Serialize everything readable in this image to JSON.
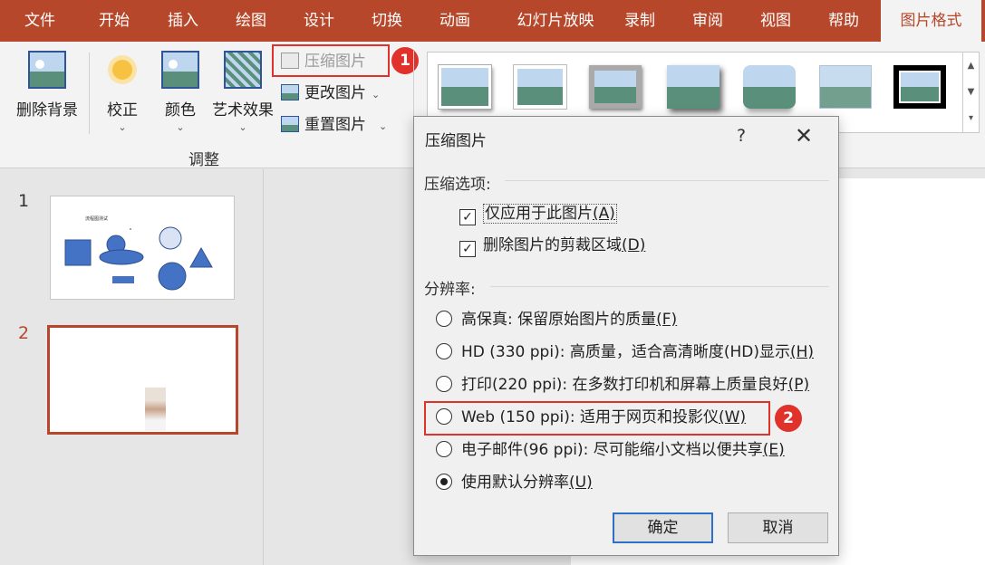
{
  "tabs": [
    {
      "label": "文件",
      "active": false
    },
    {
      "label": "开始",
      "active": false
    },
    {
      "label": "插入",
      "active": false
    },
    {
      "label": "绘图",
      "active": false
    },
    {
      "label": "设计",
      "active": false
    },
    {
      "label": "切换",
      "active": false
    },
    {
      "label": "动画",
      "active": false
    },
    {
      "label": "幻灯片放映",
      "active": false
    },
    {
      "label": "录制",
      "active": false
    },
    {
      "label": "审阅",
      "active": false
    },
    {
      "label": "视图",
      "active": false
    },
    {
      "label": "帮助",
      "active": false
    },
    {
      "label": "图片格式",
      "active": true
    }
  ],
  "ribbon": {
    "remove_bg": "删除背景",
    "corrections": "校正",
    "color": "颜色",
    "art_effects": "艺术效果",
    "compress": "压缩图片",
    "change": "更改图片",
    "reset": "重置图片",
    "group_label": "调整",
    "chevron": "⌄"
  },
  "gallery": {
    "scroll_up": "▲",
    "scroll_down": "▼",
    "more": "▾"
  },
  "slides": [
    {
      "number": "1",
      "title": "流程图测试",
      "selected": false
    },
    {
      "number": "2",
      "selected": true
    }
  ],
  "badges": {
    "one": "1",
    "two": "2"
  },
  "dialog": {
    "title": "压缩图片",
    "help": "?",
    "close": "✕",
    "compress_options_label": "压缩选项:",
    "checkmark": "✓",
    "checkbox_apply_only": {
      "text": "仅应用于此图片",
      "key": "(A)",
      "checked": true
    },
    "checkbox_delete_cropped": {
      "text": "删除图片的剪裁区域",
      "key": "(D)",
      "checked": true
    },
    "resolution_label": "分辨率:",
    "options": [
      {
        "text": "高保真: 保留原始图片的质量",
        "key": "(F)",
        "selected": false
      },
      {
        "text": "HD (330 ppi): 高质量，适合高清晰度(HD)显示",
        "key": "(H)",
        "selected": false
      },
      {
        "text": "打印(220 ppi): 在多数打印机和屏幕上质量良好",
        "key": "(P)",
        "selected": false
      },
      {
        "text": "Web (150 ppi): 适用于网页和投影仪",
        "key": "(W)",
        "selected": false
      },
      {
        "text": "电子邮件(96 ppi): 尽可能缩小文档以便共享",
        "key": "(E)",
        "selected": false
      },
      {
        "text": "使用默认分辨率",
        "key": "(U)",
        "selected": true
      }
    ],
    "ok": "确定",
    "cancel": "取消"
  },
  "colors": {
    "accent": "#b7472a",
    "highlight": "#e0312b",
    "shape_fill": "#4472c4"
  }
}
